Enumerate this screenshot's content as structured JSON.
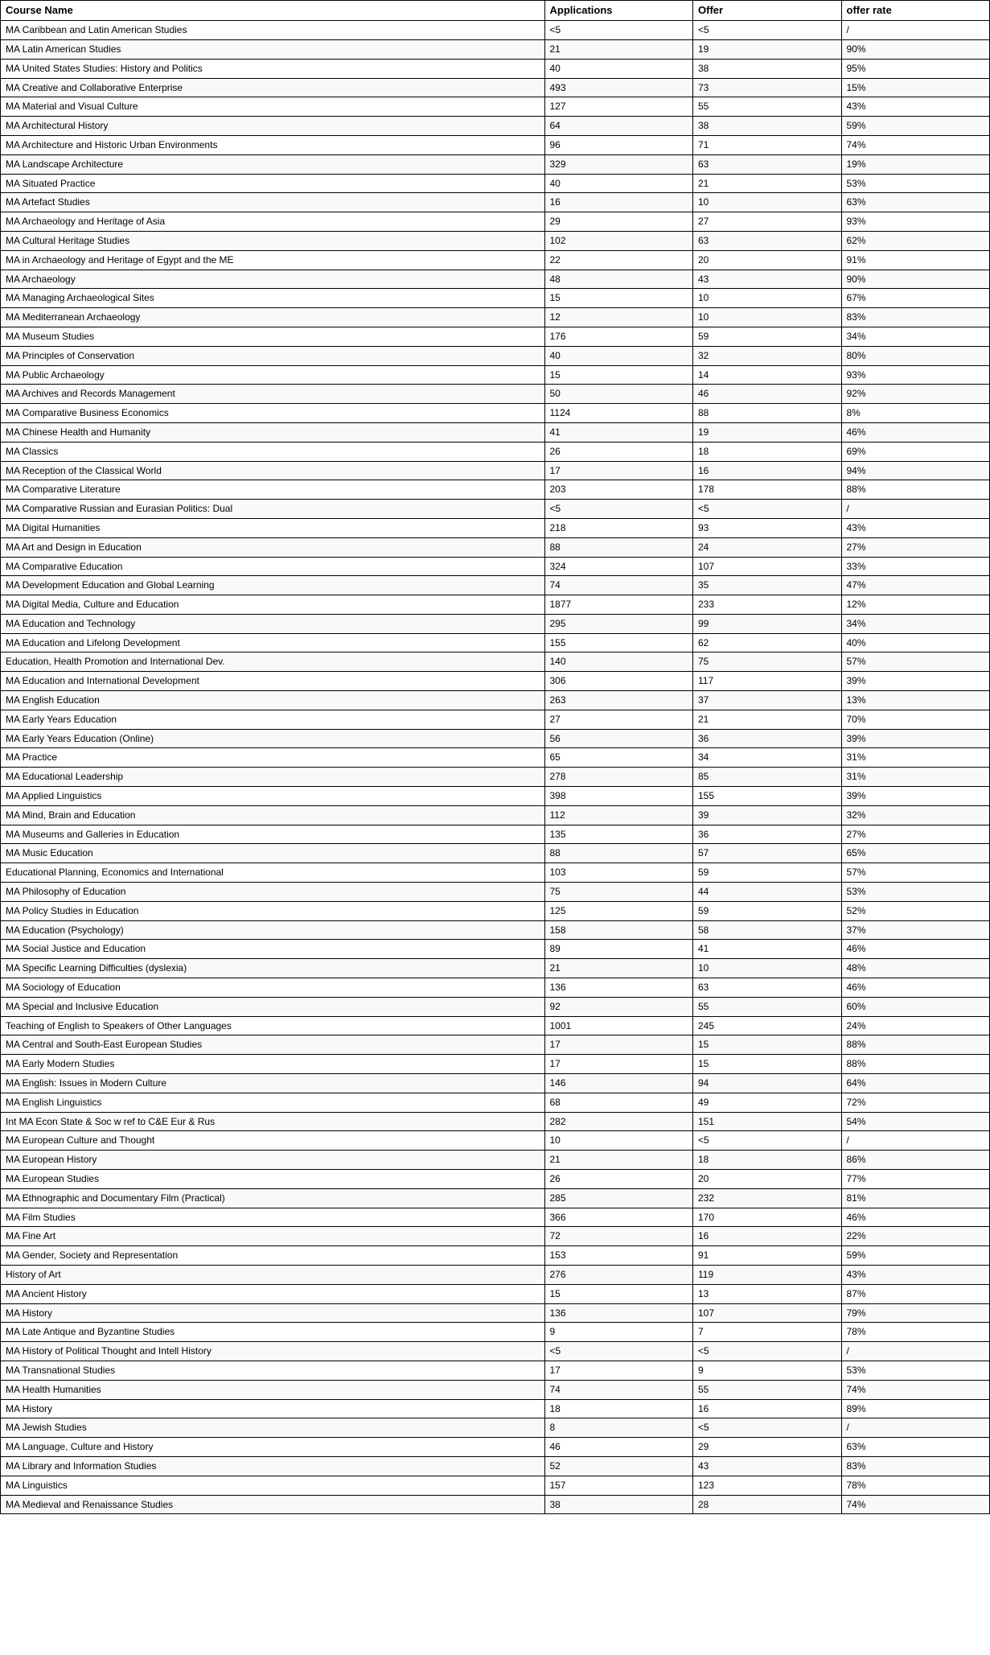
{
  "table": {
    "headers": [
      "Course Name",
      "Applications",
      "Offer",
      "offer rate"
    ],
    "rows": [
      [
        "MA Caribbean and Latin American Studies",
        "<5",
        "<5",
        "/"
      ],
      [
        "MA Latin American Studies",
        "21",
        "19",
        "90%"
      ],
      [
        "MA United States Studies: History and Politics",
        "40",
        "38",
        "95%"
      ],
      [
        "MA Creative and Collaborative Enterprise",
        "493",
        "73",
        "15%"
      ],
      [
        "MA Material and Visual Culture",
        "127",
        "55",
        "43%"
      ],
      [
        "MA Architectural History",
        "64",
        "38",
        "59%"
      ],
      [
        "MA Architecture and Historic Urban Environments",
        "96",
        "71",
        "74%"
      ],
      [
        "MA Landscape Architecture",
        "329",
        "63",
        "19%"
      ],
      [
        "MA Situated Practice",
        "40",
        "21",
        "53%"
      ],
      [
        "MA Artefact Studies",
        "16",
        "10",
        "63%"
      ],
      [
        "MA Archaeology and Heritage of Asia",
        "29",
        "27",
        "93%"
      ],
      [
        "MA Cultural Heritage Studies",
        "102",
        "63",
        "62%"
      ],
      [
        "MA in Archaeology and Heritage of Egypt and the ME",
        "22",
        "20",
        "91%"
      ],
      [
        "MA Archaeology",
        "48",
        "43",
        "90%"
      ],
      [
        "MA Managing Archaeological Sites",
        "15",
        "10",
        "67%"
      ],
      [
        "MA Mediterranean Archaeology",
        "12",
        "10",
        "83%"
      ],
      [
        "MA Museum Studies",
        "176",
        "59",
        "34%"
      ],
      [
        "MA Principles of Conservation",
        "40",
        "32",
        "80%"
      ],
      [
        "MA Public Archaeology",
        "15",
        "14",
        "93%"
      ],
      [
        "MA Archives and Records Management",
        "50",
        "46",
        "92%"
      ],
      [
        "MA Comparative Business Economics",
        "1124",
        "88",
        "8%"
      ],
      [
        "MA Chinese Health and Humanity",
        "41",
        "19",
        "46%"
      ],
      [
        "MA Classics",
        "26",
        "18",
        "69%"
      ],
      [
        "MA Reception of the Classical World",
        "17",
        "16",
        "94%"
      ],
      [
        "MA Comparative Literature",
        "203",
        "178",
        "88%"
      ],
      [
        "MA Comparative Russian and Eurasian Politics: Dual",
        "<5",
        "<5",
        "/"
      ],
      [
        "MA Digital Humanities",
        "218",
        "93",
        "43%"
      ],
      [
        "MA Art and Design in Education",
        "88",
        "24",
        "27%"
      ],
      [
        "MA Comparative Education",
        "324",
        "107",
        "33%"
      ],
      [
        "MA Development Education and Global Learning",
        "74",
        "35",
        "47%"
      ],
      [
        "MA Digital Media, Culture and Education",
        "1877",
        "233",
        "12%"
      ],
      [
        "MA Education and Technology",
        "295",
        "99",
        "34%"
      ],
      [
        "MA Education and Lifelong Development",
        "155",
        "62",
        "40%"
      ],
      [
        "Education, Health Promotion and International Dev.",
        "140",
        "75",
        "57%"
      ],
      [
        "MA Education and International Development",
        "306",
        "117",
        "39%"
      ],
      [
        "MA English Education",
        "263",
        "37",
        "13%"
      ],
      [
        "MA Early Years Education",
        "27",
        "21",
        "70%"
      ],
      [
        "MA Early Years Education (Online)",
        "56",
        "36",
        "39%"
      ],
      [
        "MA Practice",
        "65",
        "34",
        "31%"
      ],
      [
        "MA Educational Leadership",
        "278",
        "85",
        "31%"
      ],
      [
        "MA Applied Linguistics",
        "398",
        "155",
        "39%"
      ],
      [
        "MA Mind, Brain and Education",
        "112",
        "39",
        "32%"
      ],
      [
        "MA Museums and Galleries in Education",
        "135",
        "36",
        "27%"
      ],
      [
        "MA Music Education",
        "88",
        "57",
        "65%"
      ],
      [
        "Educational Planning, Economics and International",
        "103",
        "59",
        "57%"
      ],
      [
        "MA Philosophy of Education",
        "75",
        "44",
        "53%"
      ],
      [
        "MA Policy Studies in Education",
        "125",
        "59",
        "52%"
      ],
      [
        "MA Education (Psychology)",
        "158",
        "58",
        "37%"
      ],
      [
        "MA Social Justice and Education",
        "89",
        "41",
        "46%"
      ],
      [
        "MA Specific Learning Difficulties (dyslexia)",
        "21",
        "10",
        "48%"
      ],
      [
        "MA Sociology of Education",
        "136",
        "63",
        "46%"
      ],
      [
        "MA Special and Inclusive Education",
        "92",
        "55",
        "60%"
      ],
      [
        "Teaching of English to Speakers of Other Languages",
        "1001",
        "245",
        "24%"
      ],
      [
        "MA Central and South-East European Studies",
        "17",
        "15",
        "88%"
      ],
      [
        "MA Early Modern Studies",
        "17",
        "15",
        "88%"
      ],
      [
        "MA English: Issues in Modern Culture",
        "146",
        "94",
        "64%"
      ],
      [
        "MA English Linguistics",
        "68",
        "49",
        "72%"
      ],
      [
        "Int MA Econ State & Soc w ref to C&E Eur & Rus",
        "282",
        "151",
        "54%"
      ],
      [
        "MA European Culture and Thought",
        "10",
        "<5",
        "/"
      ],
      [
        "MA European History",
        "21",
        "18",
        "86%"
      ],
      [
        "MA European Studies",
        "26",
        "20",
        "77%"
      ],
      [
        "MA Ethnographic and Documentary Film (Practical)",
        "285",
        "232",
        "81%"
      ],
      [
        "MA Film Studies",
        "366",
        "170",
        "46%"
      ],
      [
        "MA Fine Art",
        "72",
        "16",
        "22%"
      ],
      [
        "MA Gender, Society and Representation",
        "153",
        "91",
        "59%"
      ],
      [
        "History of Art",
        "276",
        "119",
        "43%"
      ],
      [
        "MA Ancient History",
        "15",
        "13",
        "87%"
      ],
      [
        "MA History",
        "136",
        "107",
        "79%"
      ],
      [
        "MA Late Antique and Byzantine Studies",
        "9",
        "7",
        "78%"
      ],
      [
        "MA History of Political Thought and Intell History",
        "<5",
        "<5",
        "/"
      ],
      [
        "MA Transnational Studies",
        "17",
        "9",
        "53%"
      ],
      [
        "MA Health Humanities",
        "74",
        "55",
        "74%"
      ],
      [
        "MA History",
        "18",
        "16",
        "89%"
      ],
      [
        "MA Jewish Studies",
        "8",
        "<5",
        "/"
      ],
      [
        "MA Language, Culture and History",
        "46",
        "29",
        "63%"
      ],
      [
        "MA Library and Information Studies",
        "52",
        "43",
        "83%"
      ],
      [
        "MA Linguistics",
        "157",
        "123",
        "78%"
      ],
      [
        "MA Medieval and Renaissance Studies",
        "38",
        "28",
        "74%"
      ]
    ]
  }
}
